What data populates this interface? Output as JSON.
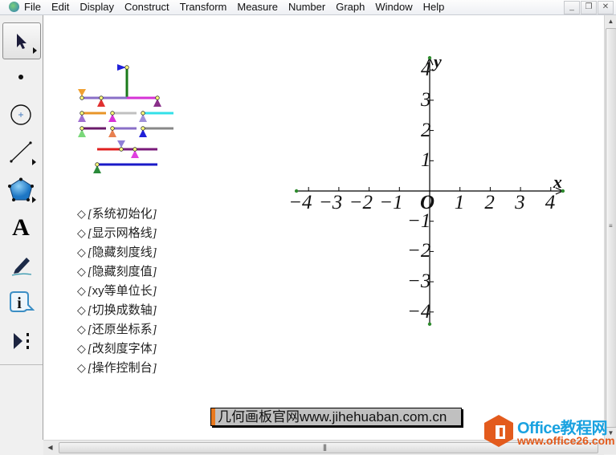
{
  "menubar": {
    "items": [
      "File",
      "Edit",
      "Display",
      "Construct",
      "Transform",
      "Measure",
      "Number",
      "Graph",
      "Window",
      "Help"
    ],
    "window_buttons": {
      "minimize": "_",
      "restore": "❐",
      "close": "✕"
    }
  },
  "toolbar": {
    "tools": [
      {
        "name": "arrow-select-tool",
        "icon": "arrow-icon",
        "selected": true
      },
      {
        "name": "point-tool",
        "icon": "point-icon"
      },
      {
        "name": "compass-tool",
        "icon": "circle-icon"
      },
      {
        "name": "straightedge-tool",
        "icon": "segment-icon"
      },
      {
        "name": "polygon-tool",
        "icon": "polygon-icon"
      },
      {
        "name": "text-tool",
        "icon": "text-a-icon",
        "label": "A"
      },
      {
        "name": "marker-tool",
        "icon": "pen-icon"
      },
      {
        "name": "information-tool",
        "icon": "info-icon",
        "label": "i"
      },
      {
        "name": "custom-tool",
        "icon": "custom-tools-icon"
      }
    ]
  },
  "action_buttons": [
    {
      "symbol": "◇",
      "label": "系统初始化"
    },
    {
      "symbol": "◇",
      "label": "显示网格线"
    },
    {
      "symbol": "◇",
      "label": "隐藏刻度线"
    },
    {
      "symbol": "◇",
      "label": "隐藏刻度值"
    },
    {
      "symbol": "◇",
      "label": "xy等单位长"
    },
    {
      "symbol": "◇",
      "label": "切换成数轴"
    },
    {
      "symbol": "◇",
      "label": "还原坐标系"
    },
    {
      "symbol": "◇",
      "label": "改刻度字体"
    },
    {
      "symbol": "◇",
      "label": "操作控制台"
    }
  ],
  "bracket_open": "[",
  "bracket_close": "]",
  "coordinate_system": {
    "x_axis_name": "x",
    "y_axis_name": "y",
    "origin_label": "O",
    "x_range": [
      -4.4,
      4.4
    ],
    "y_range": [
      -4.4,
      4.4
    ],
    "x_ticks": [
      {
        "value": -4,
        "label": "−4"
      },
      {
        "value": -3,
        "label": "−3"
      },
      {
        "value": -2,
        "label": "−2"
      },
      {
        "value": -1,
        "label": "−1"
      },
      {
        "value": 1,
        "label": "1"
      },
      {
        "value": 2,
        "label": "2"
      },
      {
        "value": 3,
        "label": "3"
      },
      {
        "value": 4,
        "label": "4"
      }
    ],
    "y_ticks": [
      {
        "value": 4,
        "label": "4"
      },
      {
        "value": 3,
        "label": "3"
      },
      {
        "value": 2,
        "label": "2"
      },
      {
        "value": 1,
        "label": "1"
      },
      {
        "value": -1,
        "label": "−1"
      },
      {
        "value": -2,
        "label": "−2"
      },
      {
        "value": -3,
        "label": "−3"
      },
      {
        "value": -4,
        "label": "−4"
      }
    ],
    "axis_color": "#000000",
    "endpoint_color": "#2e8b2e"
  },
  "control_panel": {
    "flag_color": "#2020d8",
    "pole_color": "#1a7a1a",
    "sliders": [
      {
        "color": "#8a6fc7",
        "handle": "#e03030"
      },
      {
        "color": "#d633d6",
        "handle": "#8a2f8a"
      },
      {
        "color": "#e89528",
        "handle": "#a070d0"
      },
      {
        "color": "#c0c0c0",
        "handle": "#d633d6"
      },
      {
        "color": "#33e0e8",
        "handle": "#a090d8"
      },
      {
        "color": "#6a1a6a",
        "handle": "#7ad87a"
      },
      {
        "color": "#8a6fc7",
        "handle": "#e88050"
      },
      {
        "color": "#888888",
        "handle": "#2020d8"
      },
      {
        "color": "#e02020",
        "handle": "#9080d8"
      },
      {
        "color": "#7a1a7a",
        "handle": "#e040e0"
      },
      {
        "color": "#1a1ac8",
        "handle": "#2a8a3a"
      }
    ]
  },
  "url_banner": {
    "text": "几何画板官网www.jihehuaban.com.cn",
    "accent": "#e8791e"
  },
  "watermark": {
    "title": "Office教程网",
    "url": "www.office26.com",
    "brand_color": "#e35b1d",
    "title_color": "#1aa2e0"
  }
}
